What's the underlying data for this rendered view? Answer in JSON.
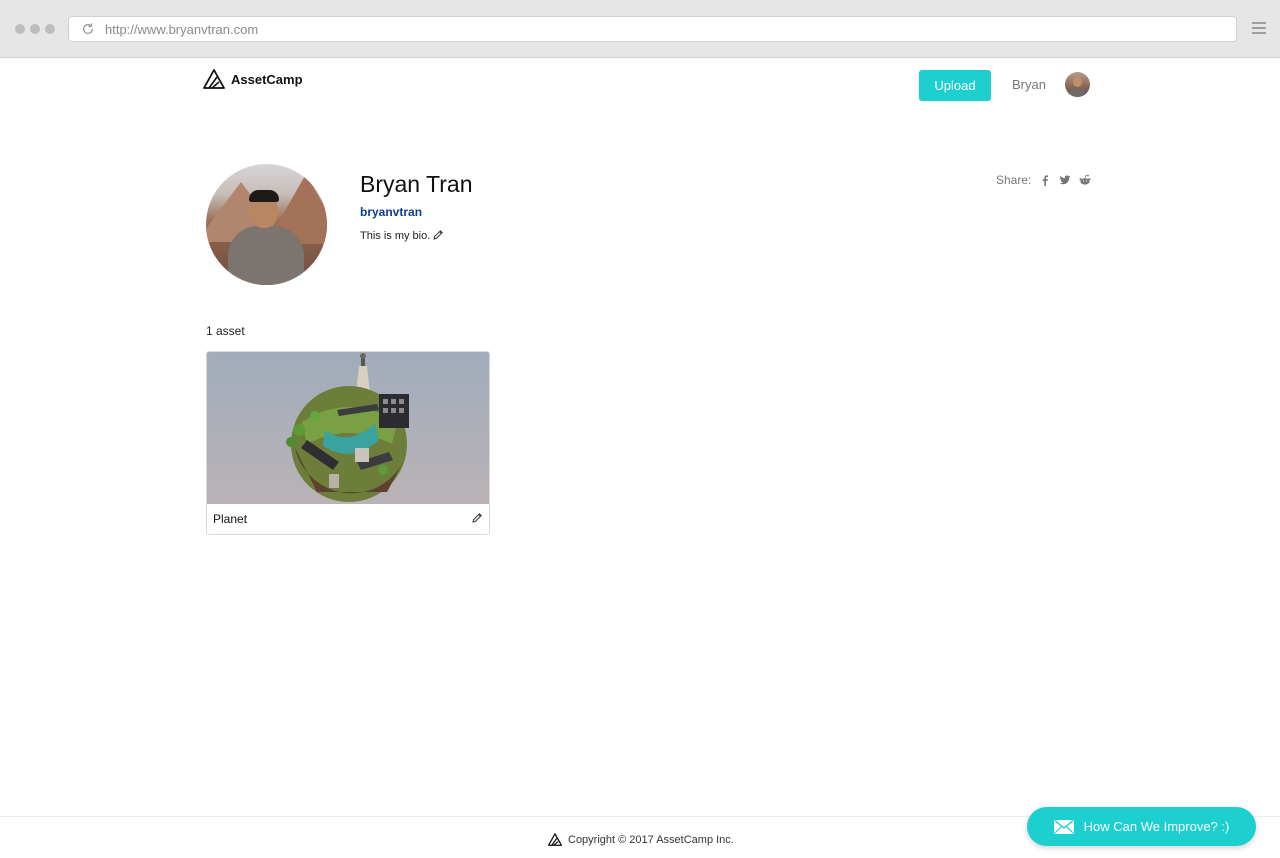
{
  "browser": {
    "url": "http://www.bryanvtran.com"
  },
  "header": {
    "logo_text": "AssetCamp",
    "upload_label": "Upload",
    "user_name": "Bryan"
  },
  "profile": {
    "name": "Bryan Tran",
    "username": "bryanvtran",
    "bio": "This is my bio.",
    "share_label": "Share:",
    "share_icons": [
      "facebook-icon",
      "twitter-icon",
      "reddit-icon"
    ]
  },
  "assets": {
    "count_label": "1 asset",
    "items": [
      {
        "title": "Planet"
      }
    ]
  },
  "footer": {
    "copyright": "Copyright © 2017 AssetCamp Inc."
  },
  "feedback": {
    "label": "How Can We Improve? :)"
  },
  "colors": {
    "accent": "#1ecfd0",
    "username_link": "#0b3d91"
  }
}
